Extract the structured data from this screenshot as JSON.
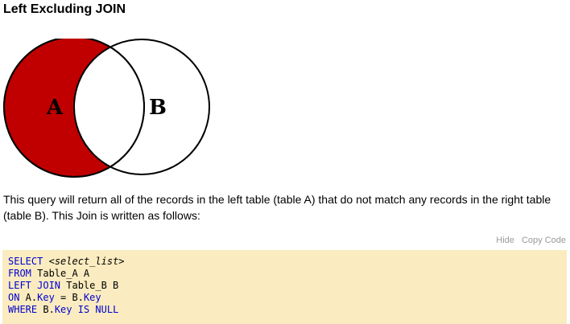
{
  "heading": "Left Excluding JOIN",
  "venn": {
    "left_label": "A",
    "right_label": "B",
    "fill_color": "#c00000"
  },
  "description": "This query will return all of the records in the left table (table A) that do not match any records in the right table (table B). This Join is written as follows:",
  "toolbar": {
    "hide_label": "Hide",
    "copy_label": "Copy Code"
  },
  "code": {
    "line1": {
      "kw": "SELECT",
      "rest": "<select_list>"
    },
    "line2": {
      "kw": "FROM",
      "rest": " Table_A A"
    },
    "line3": {
      "kw": "LEFT JOIN",
      "rest": " Table_B B"
    },
    "line4": {
      "kw": "ON",
      "a": " A.",
      "k1": "Key",
      "b": " = B.",
      "k2": "Key"
    },
    "line5": {
      "kw": "WHERE",
      "a": " B.",
      "k1": "Key",
      "kw2": "IS NULL"
    }
  },
  "colors": {
    "code_background": "#faecc0",
    "keyword": "#0000d0"
  }
}
